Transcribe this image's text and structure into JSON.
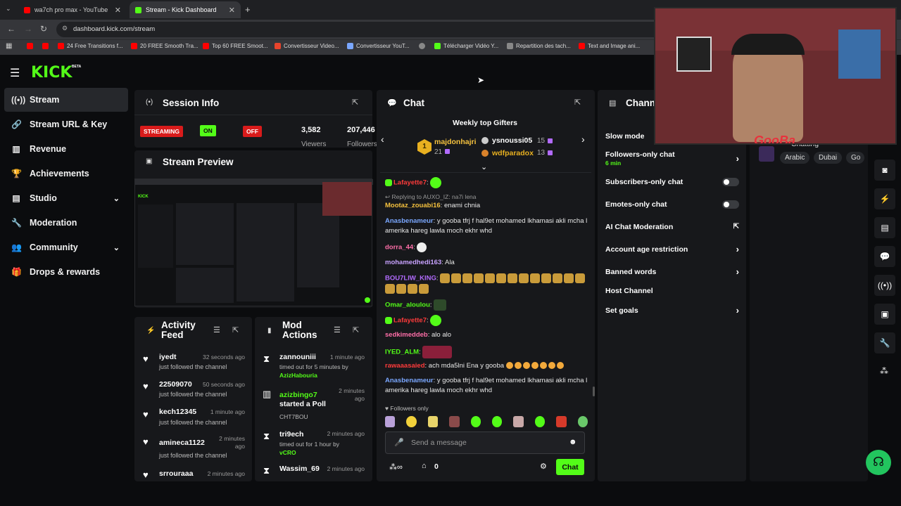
{
  "browser": {
    "tabs": [
      {
        "title": "wa7ch pro max - YouTube"
      },
      {
        "title": "Stream - Kick Dashboard"
      }
    ],
    "url": "dashboard.kick.com/stream",
    "bookmarks": [
      "24 Free Transitions f...",
      "20 FREE Smooth Tra...",
      "Top 60 FREE Smoot...",
      "Convertisseur Video...",
      "Convertisseur YouT...",
      "Télécharger Vidéo Y...",
      "Repartition des tach...",
      "Text and Image ani..."
    ]
  },
  "brand": {
    "logo": "KICK",
    "beta": "BETA",
    "accent": "#53fc18"
  },
  "sidebar": {
    "items": [
      {
        "label": "Stream",
        "icon": "broadcast-icon"
      },
      {
        "label": "Stream URL & Key",
        "icon": "link-icon"
      },
      {
        "label": "Revenue",
        "icon": "chart-icon"
      },
      {
        "label": "Achievements",
        "icon": "trophy-icon"
      },
      {
        "label": "Studio",
        "icon": "film-icon"
      },
      {
        "label": "Moderation",
        "icon": "wrench-icon"
      },
      {
        "label": "Community",
        "icon": "people-icon"
      },
      {
        "label": "Drops & rewards",
        "icon": "gift-icon"
      }
    ]
  },
  "session": {
    "title": "Session Info",
    "streaming": "STREAMING",
    "on": "ON",
    "off": "OFF",
    "viewers_value": "3,582",
    "viewers_label": "Viewers",
    "followers_value": "207,446",
    "followers_label": "Followers"
  },
  "preview": {
    "title": "Stream Preview"
  },
  "activity": {
    "title_line1": "Activity",
    "title_line2": "Feed",
    "items": [
      {
        "name": "iyedt",
        "time": "32 seconds ago",
        "text": "just followed the channel"
      },
      {
        "name": "22509070",
        "time": "50 seconds ago",
        "text": "just followed the channel"
      },
      {
        "name": "kech12345",
        "time": "1 minute ago",
        "text": "just followed the channel"
      },
      {
        "name": "amineca1122",
        "time": "2 minutes ago",
        "text": "just followed the channel"
      },
      {
        "name": "srrouraaa",
        "time": "2 minutes ago",
        "text": ""
      }
    ]
  },
  "mod": {
    "title_line1": "Mod",
    "title_line2": "Actions",
    "items": [
      {
        "name": "zannouniii",
        "time": "1 minute ago",
        "text": "timed out for 5 minutes by",
        "by": "AzizHabouria"
      },
      {
        "name": "azizbingo7",
        "time": "2 minutes ago",
        "text": "started a Poll",
        "by": "CHT7BOU"
      },
      {
        "name": "tri9ech",
        "time": "2 minutes ago",
        "text": "timed out for 1 hour by",
        "by": "vCRO"
      },
      {
        "name": "Wassim_69",
        "time": "2 minutes ago",
        "text": "",
        "by": ""
      }
    ]
  },
  "chat": {
    "title": "Chat",
    "gifters_title": "Weekly top Gifters",
    "gifters": [
      {
        "rank": "1",
        "name": "majdonhajri",
        "count": "21"
      },
      {
        "name": "ysnoussi05",
        "count": "15"
      },
      {
        "name": "wdfparadox",
        "count": "13"
      }
    ],
    "messages": [
      {
        "user": "Lafayette7",
        "color": "#ff3b3b",
        "text": ""
      },
      {
        "reply": "Replying to AUXO_IZ: na7i lena"
      },
      {
        "user": "Mootaz_zouabi16",
        "color": "#f6c23e",
        "text": "enami chnia"
      },
      {
        "user": "Anasbenameur",
        "color": "#7aa7ff",
        "text": "y gooba tfrj f hal9et mohamed lkhamasi akli mcha l amerika hareg lawla moch ekhr whd"
      },
      {
        "user": "dorra_44",
        "color": "#ff6ea8",
        "text": ""
      },
      {
        "user": "mohamedhedi163",
        "color": "#c8a2ff",
        "text": "Ala"
      },
      {
        "user": "BOU7LIW_KING",
        "color": "#b26bff",
        "text": ""
      },
      {
        "user": "Omar_aloulou",
        "color": "#53fc18",
        "text": ""
      },
      {
        "user": "Lafayette7",
        "color": "#ff3b3b",
        "text": ""
      },
      {
        "user": "sedkimeddeb",
        "color": "#ff6ea8",
        "text": "alo alo"
      },
      {
        "user": "IYED_ALM",
        "color": "#53fc18",
        "text": ""
      },
      {
        "user": "rawaaasaied",
        "color": "#ff3b3b",
        "text": "ach mda5lni Ena y gooba"
      },
      {
        "user": "Anasbenameur",
        "color": "#7aa7ff",
        "text": "y gooba tfrj f hal9et mohamed lkhamasi akli mcha l amerika hareg lawla moch ekhr whd"
      }
    ],
    "followers_only": "Followers only",
    "placeholder": "Send a message",
    "points": "0",
    "send_label": "Chat"
  },
  "channel": {
    "title": "Channel",
    "settings": [
      {
        "label": "Slow mode"
      },
      {
        "label": "Followers-only chat",
        "sub": "6 min"
      },
      {
        "label": "Subscribers-only chat"
      },
      {
        "label": "Emotes-only chat"
      },
      {
        "label": "AI Chat Moderation"
      },
      {
        "label": "Account age restriction"
      },
      {
        "label": "Banned words"
      },
      {
        "label": "Host Channel"
      },
      {
        "label": "Set goals"
      }
    ],
    "category": "Chatting",
    "tags": [
      "Arabic",
      "Dubai",
      "Go"
    ]
  },
  "overlay": {
    "name": "GooBa"
  }
}
